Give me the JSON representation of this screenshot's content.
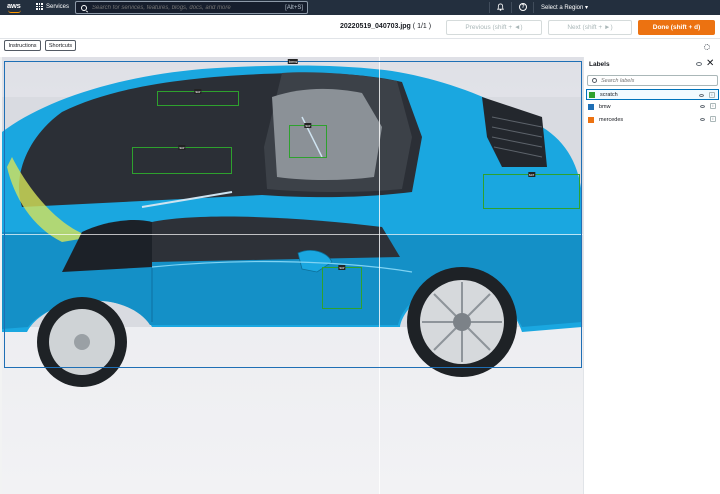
{
  "topnav": {
    "logo_text": "aws",
    "services_label": "Services",
    "search_placeholder": "Search for services, features, blogs, docs, and more",
    "search_shortcut": "[Alt+S]",
    "region_label": "Select a Region ▾"
  },
  "task": {
    "filename": "20220519_040703.jpg",
    "counter": "( 1/1 )",
    "prev_label": "Previous (shift + ◄)",
    "next_label": "Next (shift + ►)",
    "done_label": "Done (shift + d)"
  },
  "toolbar": {
    "instructions_label": "Instructions",
    "shortcuts_label": "Shortcuts"
  },
  "annotations": [
    {
      "label": "bmw"
    },
    {
      "label": "scr"
    },
    {
      "label": "scr"
    },
    {
      "label": "scr"
    },
    {
      "label": "scr"
    },
    {
      "label": "scr"
    }
  ],
  "labels_panel": {
    "title": "Labels",
    "search_placeholder": "Search labels",
    "items": [
      {
        "name": "scratch",
        "color": "#2ea12e",
        "selected": true
      },
      {
        "name": "bmw",
        "color": "#1f6fb5",
        "selected": false
      },
      {
        "name": "mercedes",
        "color": "#ec7211",
        "selected": false
      }
    ]
  },
  "colors": {
    "nav_bg": "#232f3e",
    "accent_orange": "#ec7211",
    "bbox_bmw": "#1f6fb5",
    "bbox_scratch": "#2ea12e",
    "car_body": "#1aa7e0"
  }
}
